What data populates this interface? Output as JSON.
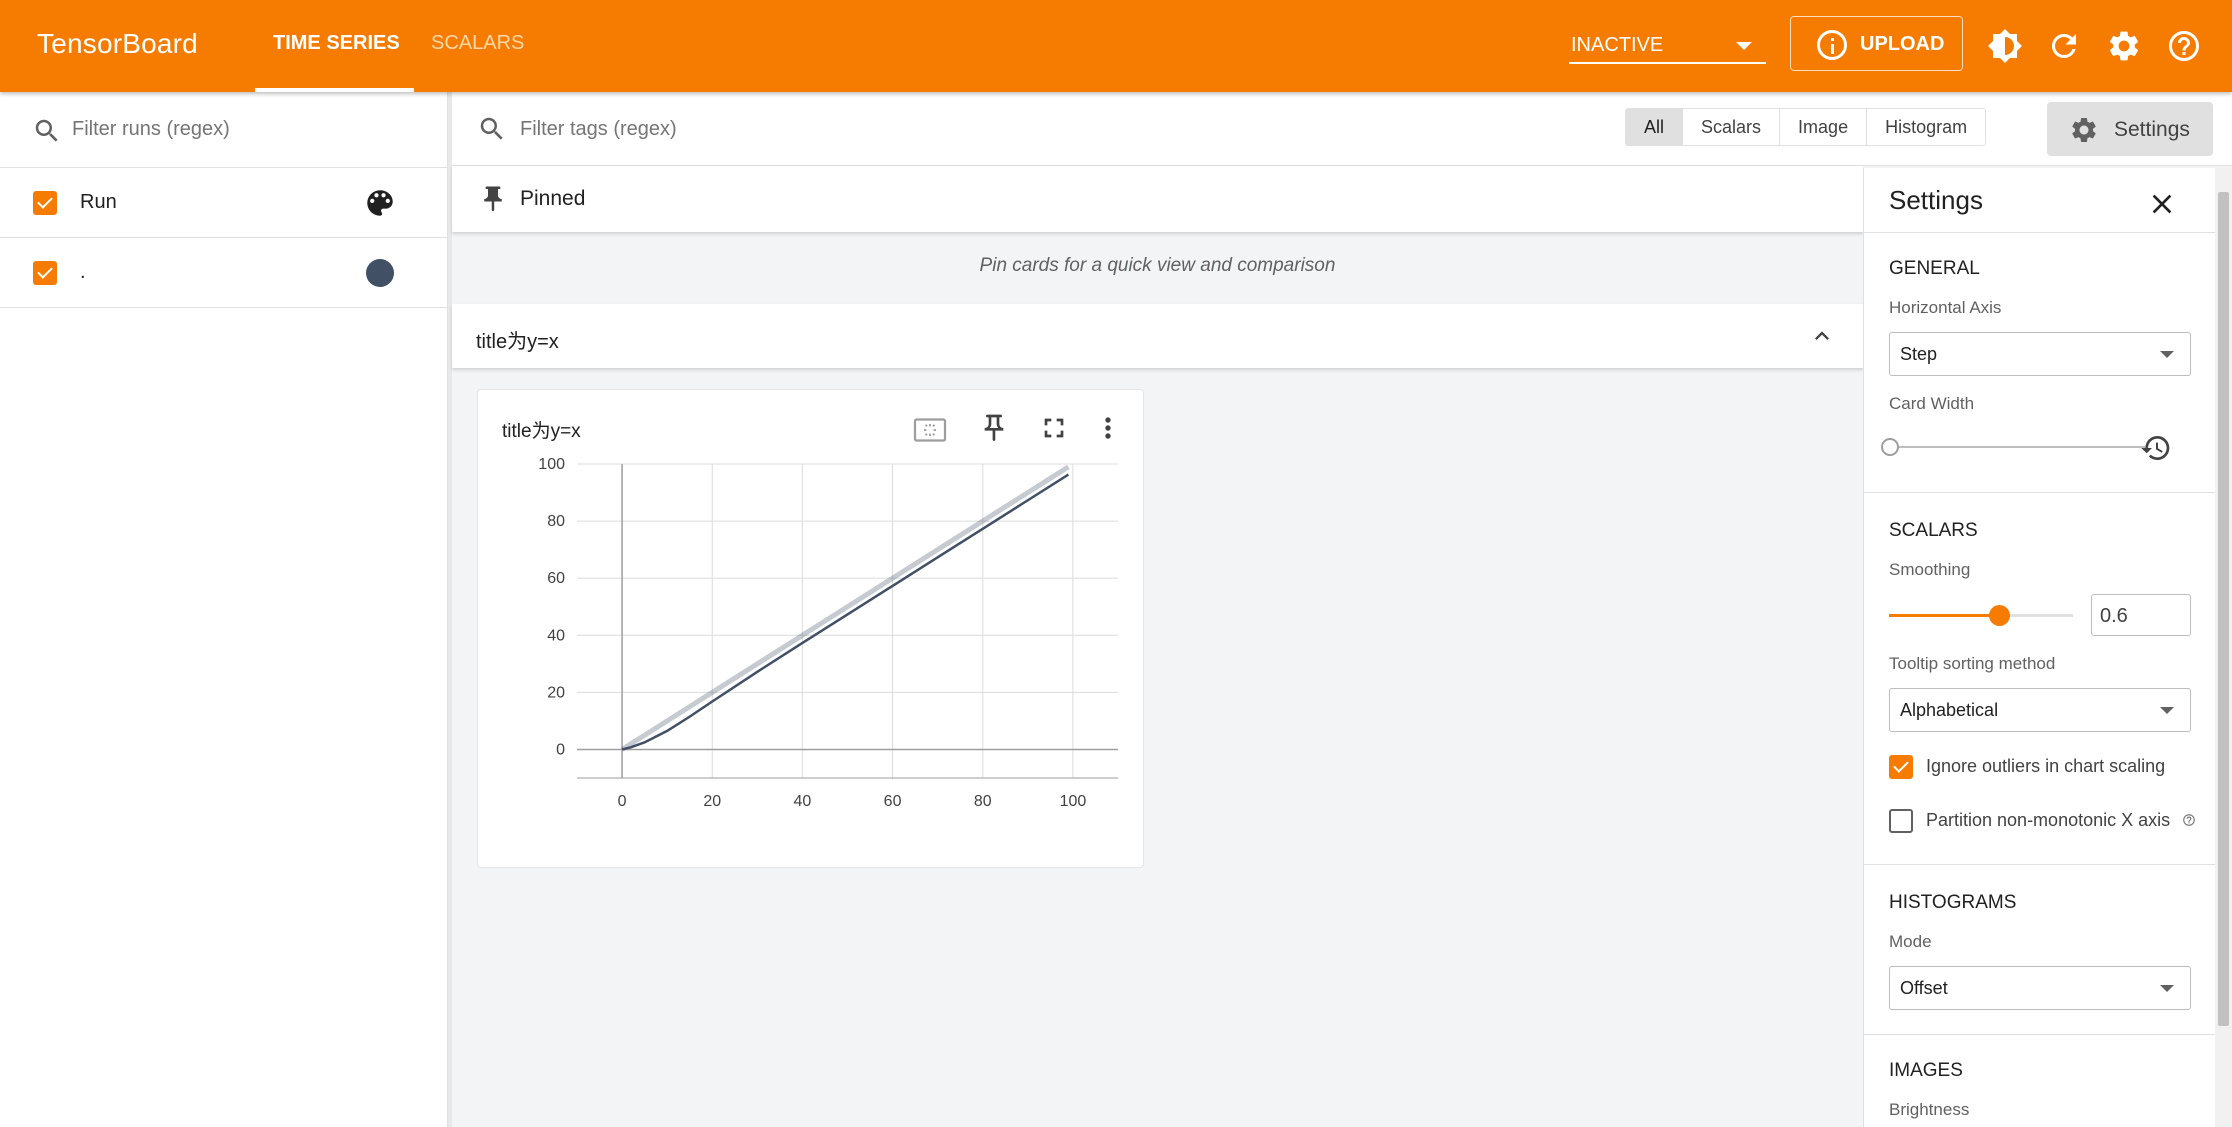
{
  "header": {
    "brand": "TensorBoard",
    "tabs": [
      {
        "label": "TIME SERIES",
        "active": true
      },
      {
        "label": "SCALARS",
        "active": false
      }
    ],
    "status": "INACTIVE",
    "upload_label": "UPLOAD",
    "icons": [
      "info-icon",
      "brightness-icon",
      "refresh-icon",
      "gear-icon",
      "help-icon"
    ],
    "accent_color": "#f57c00"
  },
  "runs_panel": {
    "filter_placeholder": "Filter runs (regex)",
    "header_label": "Run",
    "runs": [
      {
        "name": ".",
        "checked": true,
        "color": "#425066"
      }
    ]
  },
  "main": {
    "tag_filter_placeholder": "Filter tags (regex)",
    "type_filters": [
      {
        "label": "All",
        "selected": true
      },
      {
        "label": "Scalars",
        "selected": false
      },
      {
        "label": "Image",
        "selected": false
      },
      {
        "label": "Histogram",
        "selected": false
      }
    ],
    "settings_button_label": "Settings",
    "pinned_title": "Pinned",
    "pinned_empty_text": "Pin cards for a quick view and comparison",
    "group_title": "title为y=x",
    "card_title": "title为y=x"
  },
  "chart_data": {
    "type": "line",
    "title": "title为y=x",
    "xlabel": "",
    "ylabel": "",
    "x_ticks": [
      "0",
      "20",
      "40",
      "60",
      "80",
      "100"
    ],
    "y_ticks": [
      "0",
      "20",
      "40",
      "60",
      "80",
      "100"
    ],
    "xlim": [
      -10,
      110
    ],
    "ylim": [
      -10,
      100
    ],
    "grid": true,
    "series": [
      {
        "color": "#425066",
        "smoothed": [
          [
            0,
            0
          ],
          [
            2,
            0.8
          ],
          [
            5,
            2.5
          ],
          [
            10,
            6.5
          ],
          [
            15,
            11.5
          ],
          [
            20,
            16.8
          ],
          [
            30,
            27.2
          ],
          [
            40,
            37.3
          ],
          [
            50,
            47.3
          ],
          [
            60,
            57.3
          ],
          [
            70,
            67.3
          ],
          [
            80,
            77.3
          ],
          [
            90,
            87.3
          ],
          [
            99,
            96.3
          ]
        ],
        "raw": [
          [
            0,
            0
          ],
          [
            99,
            99
          ]
        ]
      }
    ]
  },
  "settings_panel": {
    "title": "Settings",
    "general": {
      "section": "GENERAL",
      "horizontal_axis_label": "Horizontal Axis",
      "horizontal_axis_value": "Step",
      "card_width_label": "Card Width",
      "card_width_value": 0
    },
    "scalars": {
      "section": "SCALARS",
      "smoothing_label": "Smoothing",
      "smoothing_value": "0.6",
      "smoothing_fraction": 0.6,
      "tooltip_label": "Tooltip sorting method",
      "tooltip_value": "Alphabetical",
      "ignore_outliers_label": "Ignore outliers in chart scaling",
      "ignore_outliers_checked": true,
      "partition_label": "Partition non-monotonic X axis",
      "partition_checked": false
    },
    "histograms": {
      "section": "HISTOGRAMS",
      "mode_label": "Mode",
      "mode_value": "Offset"
    },
    "images": {
      "section": "IMAGES",
      "brightness_label": "Brightness"
    }
  }
}
